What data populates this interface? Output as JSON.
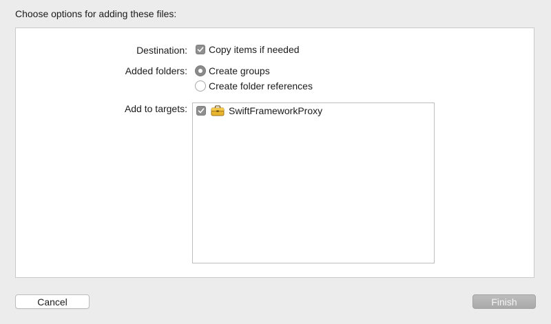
{
  "dialog": {
    "heading": "Choose options for adding these files:"
  },
  "destination": {
    "label": "Destination:",
    "option_label": "Copy items if needed",
    "checked": true
  },
  "added_folders": {
    "label": "Added folders:",
    "options": [
      {
        "label": "Create groups",
        "selected": true
      },
      {
        "label": "Create folder references",
        "selected": false
      }
    ]
  },
  "targets": {
    "label": "Add to targets:",
    "items": [
      {
        "name": "SwiftFrameworkProxy",
        "checked": true,
        "icon": "toolbox-icon"
      }
    ]
  },
  "buttons": {
    "cancel_label": "Cancel",
    "finish_label": "Finish"
  },
  "colors": {
    "window_bg": "#ececec",
    "panel_bg": "#ffffff",
    "control_gray": "#8f8f8f",
    "finish_button_bg": "#b3b3b3"
  }
}
